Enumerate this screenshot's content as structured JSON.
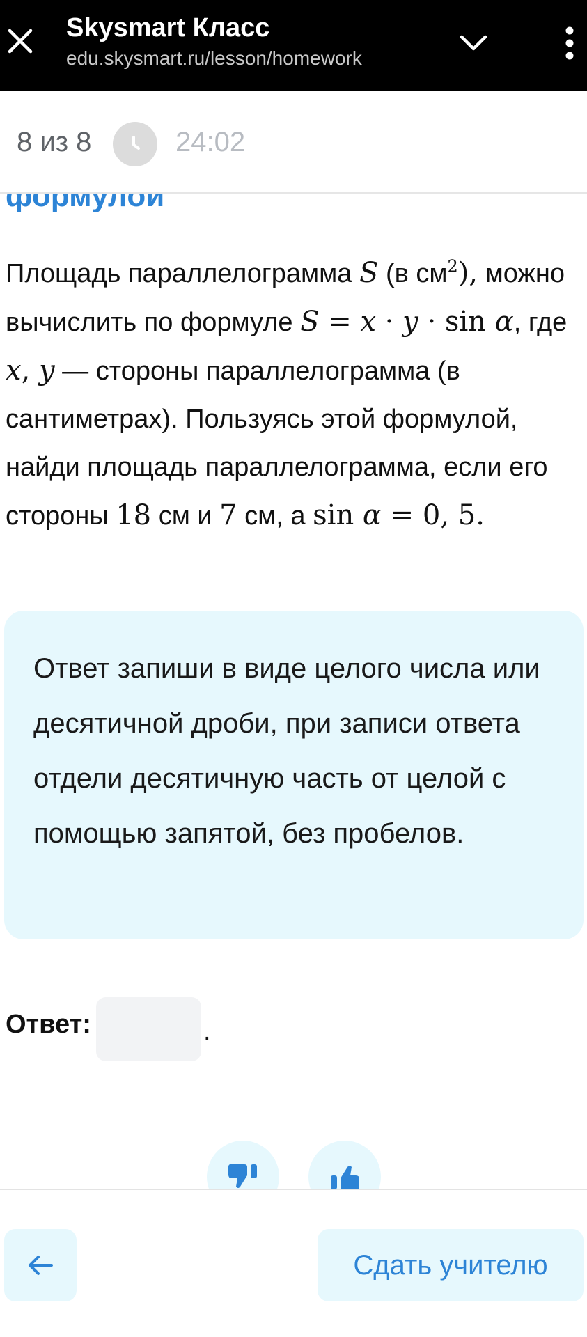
{
  "browser": {
    "title": "Skysmart Класс",
    "url": "edu.skysmart.ru/lesson/homework"
  },
  "progress": {
    "step_counter": "8 из 8",
    "timer": "24:02"
  },
  "task": {
    "heading_fragment": "формулой",
    "t1": "Площадь параллелограмма ",
    "t2": "(в см",
    "t3": "можно вычислить по формуле ",
    "t4": ", где ",
    "t5": " — стороны параллелограмма (в сантиметрах). Пользуясь этой формулой, найди площадь параллелограмма, если его стороны ",
    "t6": " см и ",
    "t7": " см, а ",
    "side_a": "18",
    "side_b": "7",
    "sin_value": "0, 5"
  },
  "hint": {
    "text": "Ответ запиши в виде целого числа или десятичной дроби, при записи ответа отдели десятичную часть от целой с помощью запятой, без пробелов."
  },
  "answer": {
    "label": "Ответ:",
    "value": "",
    "period": "."
  },
  "footer": {
    "submit_label": "Сдать учителю"
  },
  "icons": {
    "close": "close-icon",
    "chevron": "chevron-down-icon",
    "more": "more-vertical-icon",
    "clock": "clock-icon",
    "dislike": "thumbs-down-icon",
    "like": "thumbs-up-icon",
    "back": "arrow-left-icon"
  },
  "colors": {
    "accent": "#2d84d6",
    "hint_bg": "#e6f8fd",
    "topbar_bg": "#000000"
  }
}
